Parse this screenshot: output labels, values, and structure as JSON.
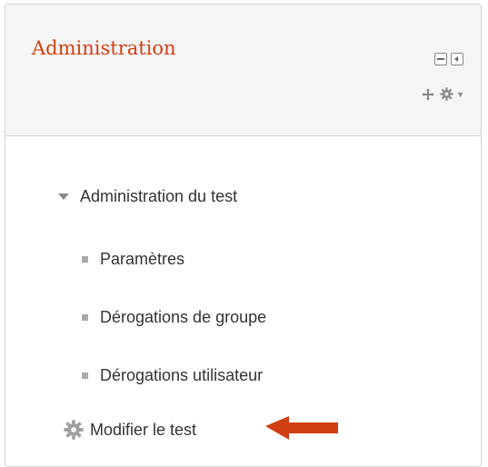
{
  "block": {
    "title": "Administration",
    "title_color": "#cf3f12",
    "header_icons": [
      "hide-block-icon",
      "dock-block-icon",
      "move-icon",
      "gear-icon",
      "caret-down-icon"
    ]
  },
  "nav": {
    "section_label": "Administration du test",
    "items": [
      {
        "label": "Paramètres"
      },
      {
        "label": "Dérogations de groupe"
      },
      {
        "label": "Dérogations utilisateur"
      }
    ],
    "edit_label": "Modifier le test"
  },
  "annotation": {
    "arrow_color": "#cf3f12",
    "icon": "arrow-left-icon"
  }
}
